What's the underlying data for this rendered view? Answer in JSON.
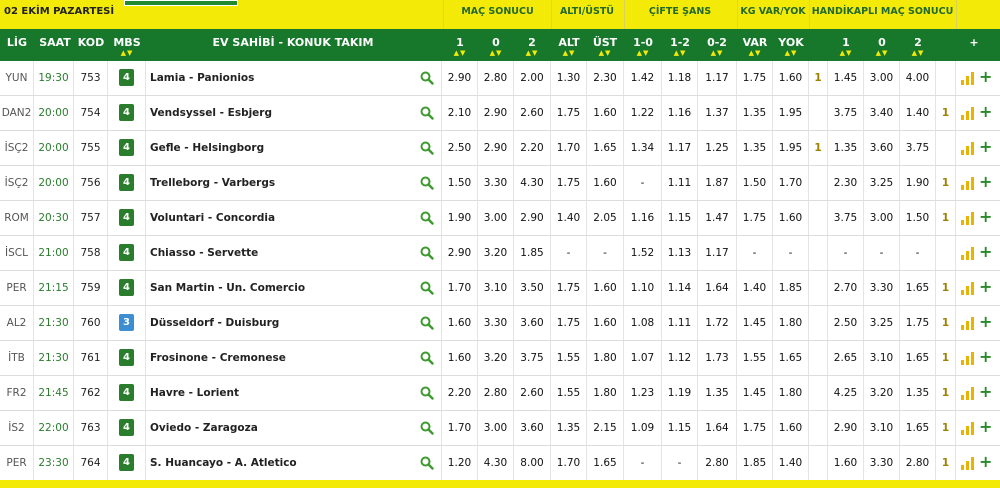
{
  "top": {
    "date": "02 EKİM PAZARTESİ"
  },
  "groups": [
    {
      "key": "mac",
      "label": "MAÇ SONUCU"
    },
    {
      "key": "alt",
      "label": "ALTI/ÜSTÜ"
    },
    {
      "key": "cifte",
      "label": "ÇİFTE ŞANS"
    },
    {
      "key": "kg",
      "label": "KG VAR/YOK"
    },
    {
      "key": "hnd",
      "label": "HANDİKAPLI MAÇ SONUCU"
    }
  ],
  "headers": {
    "lig": "LİG",
    "saat": "SAAT",
    "kod": "KOD",
    "mbs": "MBS",
    "teams": "EV SAHİBİ - KONUK TAKIM",
    "m1": "1",
    "m0": "0",
    "m2": "2",
    "alt": "ALT",
    "ust": "ÜST",
    "c10": "1-0",
    "c12": "1-2",
    "c02": "0-2",
    "var": "VAR",
    "yok": "YOK",
    "h1": "1",
    "h0": "0",
    "h2": "2",
    "plus": "+"
  },
  "arrows": "▲▼",
  "rows": [
    {
      "lig": "YUN",
      "saat": "19:30",
      "kod": "753",
      "mbs": "4",
      "teams": "Lamia - Panionios",
      "m1": "2.90",
      "m0": "2.80",
      "m2": "2.00",
      "alt": "1.30",
      "ust": "2.30",
      "c10": "1.42",
      "c12": "1.18",
      "c02": "1.17",
      "var": "1.75",
      "yok": "1.60",
      "hl": "1",
      "h1": "1.45",
      "h0": "3.00",
      "h2": "4.00",
      "hr": ""
    },
    {
      "lig": "DAN2",
      "saat": "20:00",
      "kod": "754",
      "mbs": "4",
      "teams": "Vendsyssel - Esbjerg",
      "m1": "2.10",
      "m0": "2.90",
      "m2": "2.60",
      "alt": "1.75",
      "ust": "1.60",
      "c10": "1.22",
      "c12": "1.16",
      "c02": "1.37",
      "var": "1.35",
      "yok": "1.95",
      "hl": "",
      "h1": "3.75",
      "h0": "3.40",
      "h2": "1.40",
      "hr": "1"
    },
    {
      "lig": "İSÇ2",
      "saat": "20:00",
      "kod": "755",
      "mbs": "4",
      "teams": "Gefle - Helsingborg",
      "m1": "2.50",
      "m0": "2.90",
      "m2": "2.20",
      "alt": "1.70",
      "ust": "1.65",
      "c10": "1.34",
      "c12": "1.17",
      "c02": "1.25",
      "var": "1.35",
      "yok": "1.95",
      "hl": "1",
      "h1": "1.35",
      "h0": "3.60",
      "h2": "3.75",
      "hr": ""
    },
    {
      "lig": "İSÇ2",
      "saat": "20:00",
      "kod": "756",
      "mbs": "4",
      "teams": "Trelleborg - Varbergs",
      "m1": "1.50",
      "m0": "3.30",
      "m2": "4.30",
      "alt": "1.75",
      "ust": "1.60",
      "c10": "-",
      "c12": "1.11",
      "c02": "1.87",
      "var": "1.50",
      "yok": "1.70",
      "hl": "",
      "h1": "2.30",
      "h0": "3.25",
      "h2": "1.90",
      "hr": "1"
    },
    {
      "lig": "ROM",
      "saat": "20:30",
      "kod": "757",
      "mbs": "4",
      "teams": "Voluntari - Concordia",
      "m1": "1.90",
      "m0": "3.00",
      "m2": "2.90",
      "alt": "1.40",
      "ust": "2.05",
      "c10": "1.16",
      "c12": "1.15",
      "c02": "1.47",
      "var": "1.75",
      "yok": "1.60",
      "hl": "",
      "h1": "3.75",
      "h0": "3.00",
      "h2": "1.50",
      "hr": "1"
    },
    {
      "lig": "İSCL",
      "saat": "21:00",
      "kod": "758",
      "mbs": "4",
      "teams": "Chiasso - Servette",
      "m1": "2.90",
      "m0": "3.20",
      "m2": "1.85",
      "alt": "-",
      "ust": "-",
      "c10": "1.52",
      "c12": "1.13",
      "c02": "1.17",
      "var": "-",
      "yok": "-",
      "hl": "",
      "h1": "-",
      "h0": "-",
      "h2": "-",
      "hr": ""
    },
    {
      "lig": "PER",
      "saat": "21:15",
      "kod": "759",
      "mbs": "4",
      "teams": "San Martin - Un. Comercio",
      "m1": "1.70",
      "m0": "3.10",
      "m2": "3.50",
      "alt": "1.75",
      "ust": "1.60",
      "c10": "1.10",
      "c12": "1.14",
      "c02": "1.64",
      "var": "1.40",
      "yok": "1.85",
      "hl": "",
      "h1": "2.70",
      "h0": "3.30",
      "h2": "1.65",
      "hr": "1"
    },
    {
      "lig": "AL2",
      "saat": "21:30",
      "kod": "760",
      "mbs": "3",
      "teams": "Düsseldorf - Duisburg",
      "m1": "1.60",
      "m0": "3.30",
      "m2": "3.60",
      "alt": "1.75",
      "ust": "1.60",
      "c10": "1.08",
      "c12": "1.11",
      "c02": "1.72",
      "var": "1.45",
      "yok": "1.80",
      "hl": "",
      "h1": "2.50",
      "h0": "3.25",
      "h2": "1.75",
      "hr": "1"
    },
    {
      "lig": "İTB",
      "saat": "21:30",
      "kod": "761",
      "mbs": "4",
      "teams": "Frosinone - Cremonese",
      "m1": "1.60",
      "m0": "3.20",
      "m2": "3.75",
      "alt": "1.55",
      "ust": "1.80",
      "c10": "1.07",
      "c12": "1.12",
      "c02": "1.73",
      "var": "1.55",
      "yok": "1.65",
      "hl": "",
      "h1": "2.65",
      "h0": "3.10",
      "h2": "1.65",
      "hr": "1"
    },
    {
      "lig": "FR2",
      "saat": "21:45",
      "kod": "762",
      "mbs": "4",
      "teams": "Havre - Lorient",
      "m1": "2.20",
      "m0": "2.80",
      "m2": "2.60",
      "alt": "1.55",
      "ust": "1.80",
      "c10": "1.23",
      "c12": "1.19",
      "c02": "1.35",
      "var": "1.45",
      "yok": "1.80",
      "hl": "",
      "h1": "4.25",
      "h0": "3.20",
      "h2": "1.35",
      "hr": "1"
    },
    {
      "lig": "İS2",
      "saat": "22:00",
      "kod": "763",
      "mbs": "4",
      "teams": "Oviedo - Zaragoza",
      "m1": "1.70",
      "m0": "3.00",
      "m2": "3.60",
      "alt": "1.35",
      "ust": "2.15",
      "c10": "1.09",
      "c12": "1.15",
      "c02": "1.64",
      "var": "1.75",
      "yok": "1.60",
      "hl": "",
      "h1": "2.90",
      "h0": "3.10",
      "h2": "1.65",
      "hr": "1"
    },
    {
      "lig": "PER",
      "saat": "23:30",
      "kod": "764",
      "mbs": "4",
      "teams": "S. Huancayo - A. Atletico",
      "m1": "1.20",
      "m0": "4.30",
      "m2": "8.00",
      "alt": "1.70",
      "ust": "1.65",
      "c10": "-",
      "c12": "-",
      "c02": "2.80",
      "var": "1.85",
      "yok": "1.40",
      "hl": "",
      "h1": "1.60",
      "h0": "3.30",
      "h2": "2.80",
      "hr": "1"
    }
  ],
  "colors": {
    "header_green": "#17772a",
    "accent_yellow": "#f3ea07",
    "mbs_green": "#2a7d2d",
    "mbs_blue": "#3c8ed0"
  },
  "icons": {
    "search": "search-icon",
    "stats": "bar-chart-icon",
    "add": "plus-icon"
  }
}
